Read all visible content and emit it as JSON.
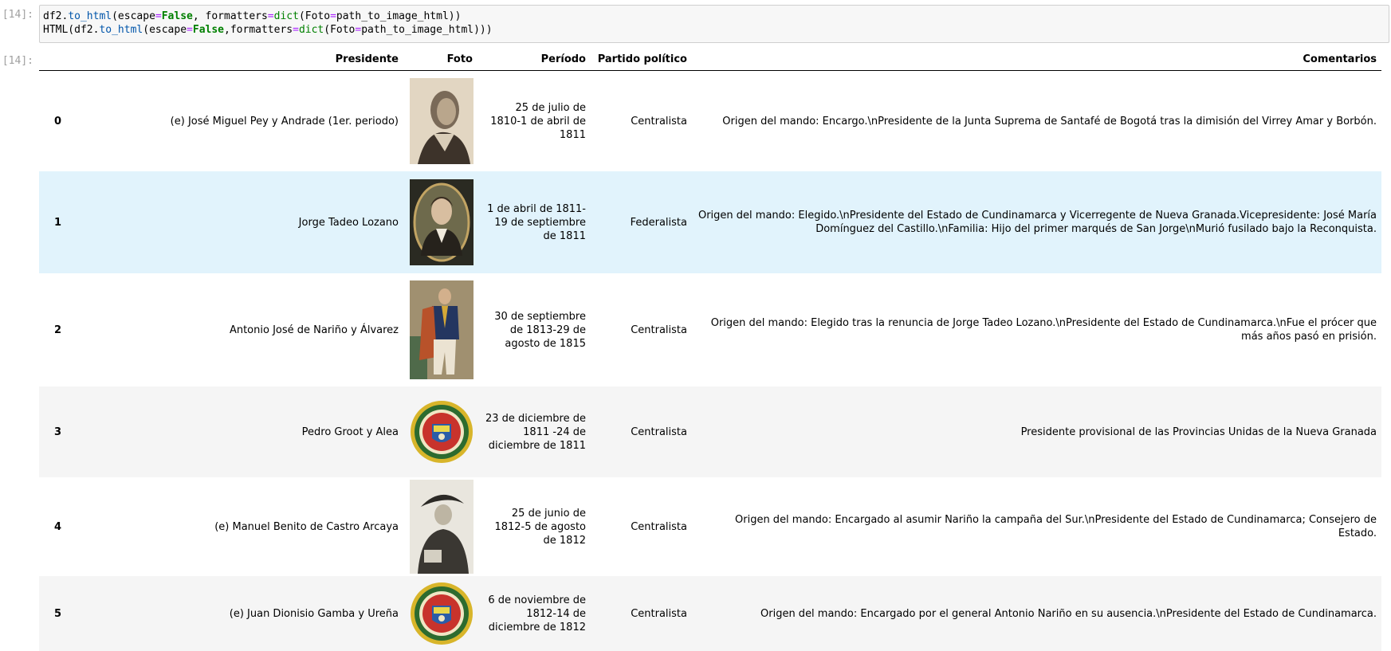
{
  "cell_in": {
    "prompt": "[14]:",
    "code_line1": {
      "p1": "df2.",
      "p2": "to_html",
      "p3": "(escape",
      "p4": "=",
      "p5": "False",
      "p6": ", formatters",
      "p7": "=",
      "p8": "dict",
      "p9": "(Foto",
      "p10": "=",
      "p11": "path_to_image_html))"
    },
    "code_line2": {
      "p1": "HTML(df2.",
      "p2": "to_html",
      "p3": "(escape",
      "p4": "=",
      "p5": "False",
      "p6": ",formatters",
      "p7": "=",
      "p8": "dict",
      "p9": "(Foto",
      "p10": "=",
      "p11": "path_to_image_html)))"
    }
  },
  "cell_out": {
    "prompt": "[14]:"
  },
  "table": {
    "headers": {
      "index": "",
      "presidente": "Presidente",
      "foto": "Foto",
      "periodo": "Período",
      "partido": "Partido político",
      "comentarios": "Comentarios"
    },
    "rows": [
      {
        "index": "0",
        "presidente": "(e) José Miguel Pey y Andrade (1er. periodo)",
        "periodo": "25 de julio de 1810-1 de abril de 1811",
        "partido": "Centralista",
        "comentarios": "Origen del mando: Encargo.\\nPresidente de la Junta Suprema de Santafé de Bogotá tras la dimisión del Virrey Amar y Borbón.",
        "photo_icon": "portrait-pey"
      },
      {
        "index": "1",
        "presidente": "Jorge Tadeo Lozano",
        "periodo": "1 de abril de 1811-19 de septiembre de 1811",
        "partido": "Federalista",
        "comentarios": "Origen del mando: Elegido.\\nPresidente del Estado de Cundinamarca y Vicerregente de Nueva Granada.Vicepresidente: José María Domínguez del Castillo.\\nFamilia: Hijo del primer marqués de San Jorge\\nMurió fusilado bajo la Reconquista.",
        "photo_icon": "portrait-lozano"
      },
      {
        "index": "2",
        "presidente": "Antonio José de Nariño y Álvarez",
        "periodo": "30 de septiembre de 1813-29 de agosto de 1815",
        "partido": "Centralista",
        "comentarios": "Origen del mando: Elegido tras la renuncia de Jorge Tadeo Lozano.\\nPresidente del Estado de Cundinamarca.\\nFue el prócer que más años pasó en prisión.",
        "photo_icon": "portrait-narino"
      },
      {
        "index": "3",
        "presidente": "Pedro Groot y Alea",
        "periodo": "23 de diciembre de 1811 -24 de diciembre de 1811",
        "partido": "Centralista",
        "comentarios": "Presidente provisional de las Provincias Unidas de la Nueva Granada",
        "photo_icon": "seal-provincias-unidas"
      },
      {
        "index": "4",
        "presidente": "(e) Manuel Benito de Castro Arcaya",
        "periodo": "25 de junio de 1812-5 de agosto de 1812",
        "partido": "Centralista",
        "comentarios": "Origen del mando: Encargado al asumir Nariño la campaña del Sur.\\nPresidente del Estado de Cundinamarca; Consejero de Estado.",
        "photo_icon": "portrait-castro"
      },
      {
        "index": "5",
        "presidente": "(e) Juan Dionisio Gamba y Ureña",
        "periodo": "6 de noviembre de 1812-14 de diciembre de 1812",
        "partido": "Centralista",
        "comentarios": "Origen del mando: Encargado por el general Antonio Nariño en su ausencia.\\nPresidente del Estado de Cundinamarca.",
        "photo_icon": "seal-provincias-unidas"
      }
    ]
  },
  "colors": {
    "hover_row": "#e1f3fc",
    "odd_row": "#f5f5f5",
    "code_bg": "#f7f7f7",
    "prompt": "#a0a0a0"
  }
}
